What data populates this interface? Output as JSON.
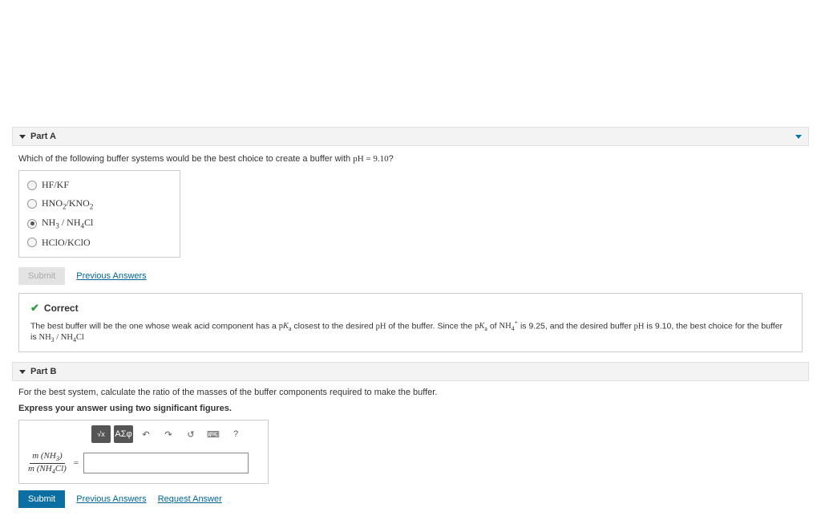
{
  "partA": {
    "label": "Part A",
    "question_prefix": "Which of the following buffer systems would be the best choice to create a buffer with ",
    "question_ph": "pH = 9.10",
    "question_suffix": "?",
    "options": [
      {
        "html": "HF/KF",
        "selected": false
      },
      {
        "html": "HNO<sub>2</sub>/KNO<sub>2</sub>",
        "selected": false
      },
      {
        "html": "NH<sub>3</sub> / NH<sub>4</sub>Cl",
        "selected": true
      },
      {
        "html": "HClO/KClO",
        "selected": false
      }
    ],
    "submit_label": "Submit",
    "prev_answers": "Previous Answers",
    "feedback_title": "Correct",
    "feedback_html": "The best buffer will be the one whose weak acid component has a <span class='serif'>p<i>K</i><sub>a</sub></span> closest to the desired <span class='serif'>pH</span> of the buffer. Since the <span class='serif'>p<i>K</i><sub>a</sub></span> of <span class='serif'>NH<sub>4</sub><sup>+</sup></span> is 9.25, and the desired buffer <span class='serif'>pH</span> is 9.10, the best choice for the buffer is <span class='serif'>NH<sub>3</sub> / NH<sub>4</sub>Cl</span>"
  },
  "partB": {
    "label": "Part B",
    "line1": "For the best system, calculate the ratio of the masses of the buffer components required to make the buffer.",
    "line2": "Express your answer using two significant figures.",
    "fraction_num": "m (NH<sub>3</sub>)",
    "fraction_den": "m (NH<sub>4</sub>Cl)",
    "equals": "=",
    "toolbar": {
      "templates": "ΑΣφ",
      "help": "?"
    },
    "submit_label": "Submit",
    "prev_answers": "Previous Answers",
    "request_answer": "Request Answer"
  }
}
